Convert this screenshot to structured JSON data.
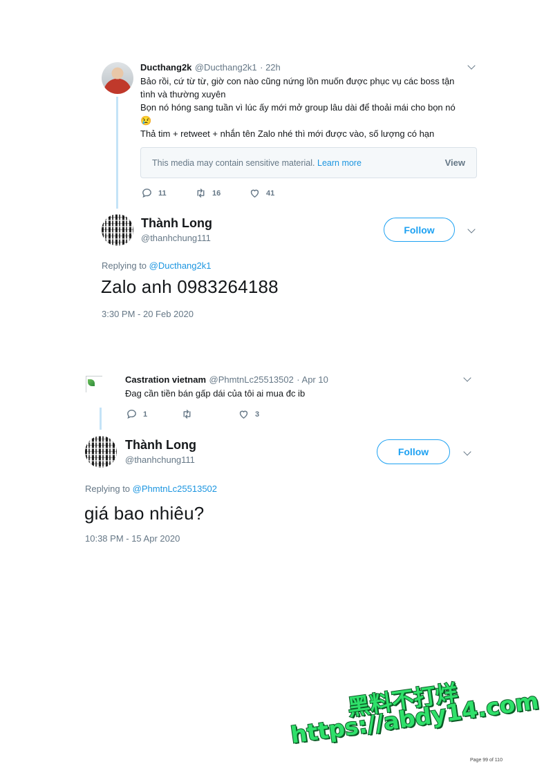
{
  "tweet1": {
    "parent": {
      "name": "Ducthang2k",
      "handle": "@Ducthang2k1",
      "time": "· 22h",
      "lines": [
        "Bảo rồi, cứ từ từ, giờ con nào cũng nứng lồn muốn được phục vụ các boss tận",
        "tình và thường xuyên",
        "Bọn nó hóng sang tuần vì lúc ấy mới mở group lâu dài để thoải mái cho bọn nó",
        "😢",
        "Thả tim + retweet + nhắn tên Zalo nhé thì mới được vào, số lượng có hạn"
      ],
      "media_notice": "This media may contain sensitive material.",
      "media_link": "Learn more",
      "media_view": "View",
      "replies": "11",
      "retweets": "16",
      "likes": "41"
    },
    "reply": {
      "name": "Thành Long",
      "handle": "@thanhchung111",
      "follow_label": "Follow",
      "replying_prefix": "Replying to",
      "replying_to": "@Ducthang2k1",
      "text": "Zalo anh 0983264188",
      "timestamp": "3:30 PM - 20 Feb 2020"
    }
  },
  "tweet2": {
    "parent": {
      "name": "Castration vietnam",
      "handle": "@PhmtnLc25513502",
      "time": "· Apr 10",
      "text": "Đag cần tiền bán gấp dái của tôi ai mua đc ib",
      "replies": "1",
      "retweets": "",
      "likes": "3"
    },
    "reply": {
      "name": "Thành Long",
      "handle": "@thanhchung111",
      "follow_label": "Follow",
      "replying_prefix": "Replying to",
      "replying_to": "@PhmtnLc25513502",
      "text": "giá bao nhiêu?",
      "timestamp": "10:38 PM - 15 Apr 2020"
    }
  },
  "watermark": {
    "line1": "黑料不打烊",
    "line2": "https://abdy14.com"
  },
  "page_number": "Page 99 of 110",
  "colors": {
    "accent": "#1da1f2",
    "muted": "#657786",
    "thread_line": "#c4e3f7",
    "watermark": "#2fe06a"
  }
}
